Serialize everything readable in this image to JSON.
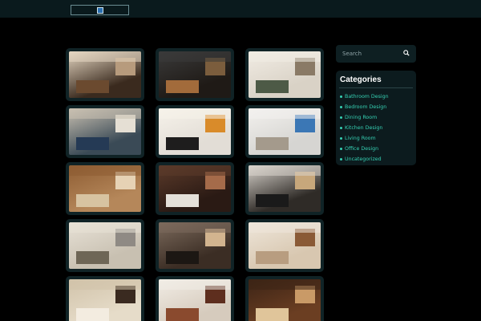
{
  "search": {
    "placeholder": "Search"
  },
  "categories": {
    "title": "Categories",
    "items": [
      "Bathroom Design",
      "Bedroom Design",
      "Dining Room",
      "Kitchen Design",
      "Living Room",
      "Office Design",
      "Uncategorized"
    ]
  },
  "thumbnails": [
    {
      "name": "kitchen-1",
      "c1": "#3a2a1e",
      "c2": "#b79b7d",
      "c3": "#e5d7c2",
      "c4": "#6b4a2f"
    },
    {
      "name": "kitchen-2",
      "c1": "#1f1a16",
      "c2": "#7b5d3d",
      "c3": "#3a3a3a",
      "c4": "#a26b3b"
    },
    {
      "name": "kitchen-3",
      "c1": "#d9d2c6",
      "c2": "#8a7a66",
      "c3": "#f1ece4",
      "c4": "#4d5a46"
    },
    {
      "name": "kitchen-4",
      "c1": "#3a4a56",
      "c2": "#e5dfd4",
      "c3": "#c9c0b1",
      "c4": "#253a55"
    },
    {
      "name": "dining-1",
      "c1": "#e2ddd6",
      "c2": "#d98b2a",
      "c3": "#f6f2ea",
      "c4": "#1e1d1d"
    },
    {
      "name": "living-1",
      "c1": "#d6d5d2",
      "c2": "#3b77b5",
      "c3": "#f3f1ee",
      "c4": "#a49a8c"
    },
    {
      "name": "kitchen-5",
      "c1": "#b5875a",
      "c2": "#e6d2b5",
      "c3": "#8e5d33",
      "c4": "#d7c3a1"
    },
    {
      "name": "dining-2",
      "c1": "#2a1a14",
      "c2": "#a56b4a",
      "c3": "#5b3a2a",
      "c4": "#e4e0d9"
    },
    {
      "name": "living-2",
      "c1": "#2f2b27",
      "c2": "#c7a77b",
      "c3": "#d8d3cc",
      "c4": "#1a1a1a"
    },
    {
      "name": "living-3",
      "c1": "#c8c0b1",
      "c2": "#8f8a84",
      "c3": "#e7e1d6",
      "c4": "#6e6656"
    },
    {
      "name": "bedroom-1",
      "c1": "#3b2d24",
      "c2": "#d2b48f",
      "c3": "#7b6a5c",
      "c4": "#1c1713"
    },
    {
      "name": "living-4",
      "c1": "#d8c7b0",
      "c2": "#8a5a36",
      "c3": "#eee6da",
      "c4": "#b89d80"
    },
    {
      "name": "bathroom-1",
      "c1": "#e6dcc9",
      "c2": "#3a2a20",
      "c3": "#d1c3aa",
      "c4": "#f3ece0"
    },
    {
      "name": "bedroom-2",
      "c1": "#d6cbbd",
      "c2": "#5e2e1e",
      "c3": "#f1ece5",
      "c4": "#8a4a2e"
    },
    {
      "name": "kitchen-6",
      "c1": "#6b3e22",
      "c2": "#c99a67",
      "c3": "#3c2416",
      "c4": "#e0c59a"
    }
  ]
}
